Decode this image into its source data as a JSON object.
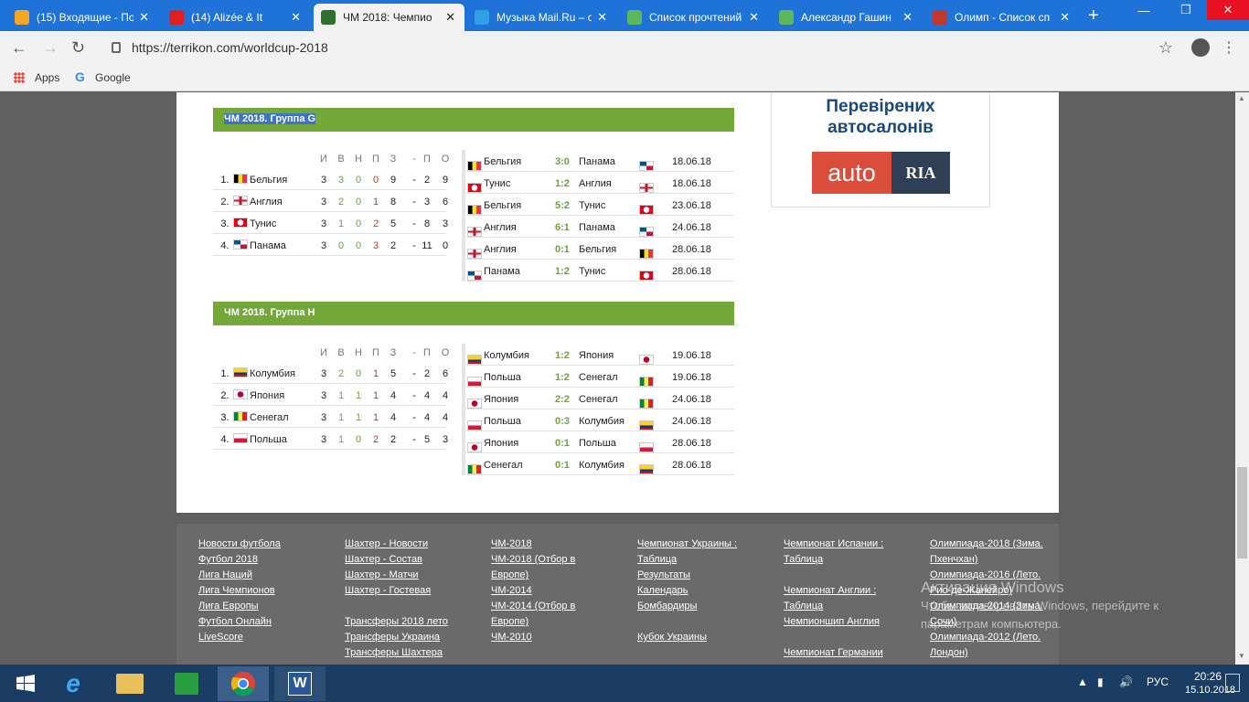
{
  "browser": {
    "tabs": [
      {
        "title": "(15) Входящие - По",
        "icon": "mailru-icon",
        "color": "#f5a623"
      },
      {
        "title": "(14) Alizée & It",
        "icon": "youtube-icon",
        "color": "#e02020"
      },
      {
        "title": "ЧМ 2018: Чемпио",
        "icon": "terrikon-icon",
        "color": "#2f6f2f",
        "active": true
      },
      {
        "title": "Музыка Mail.Ru – о",
        "icon": "mailru-music-icon",
        "color": "#2ea1e5"
      },
      {
        "title": "Список прочтений",
        "icon": "sheet-icon",
        "color": "#5cb85c"
      },
      {
        "title": "Александр Гашин",
        "icon": "sheet-icon",
        "color": "#5cb85c"
      },
      {
        "title": "Олимп - Список сп",
        "icon": "olimp-icon",
        "color": "#c0392b"
      }
    ],
    "url": "https://terrikon.com/worldcup-2018",
    "bookmarks": [
      {
        "label": "Apps",
        "icon": "apps-grid-icon"
      },
      {
        "label": "Google",
        "icon": "google-icon"
      }
    ]
  },
  "ad": {
    "title_line1": "Перевірених",
    "title_line2": "автосалонів",
    "logo_left": "auto",
    "logo_right": "RIA"
  },
  "columns": {
    "p": "И",
    "w": "В",
    "d": "Н",
    "l": "П",
    "gf": "З",
    "sep": "-",
    "ga": "П",
    "pts": "О"
  },
  "groups": [
    {
      "title": "ЧМ 2018. Группа G",
      "standings": [
        {
          "pos": "1.",
          "team": "Бельгия",
          "flag": "belgium",
          "p": "3",
          "w": "3",
          "d": "0",
          "l": "0",
          "gf": "9",
          "sep": "-",
          "ga": "2",
          "pts": "9"
        },
        {
          "pos": "2.",
          "team": "Англия",
          "flag": "england",
          "p": "3",
          "w": "2",
          "d": "0",
          "l": "1",
          "gf": "8",
          "sep": "-",
          "ga": "3",
          "pts": "6"
        },
        {
          "pos": "3.",
          "team": "Тунис",
          "flag": "tunisia",
          "p": "3",
          "w": "1",
          "d": "0",
          "l": "2",
          "gf": "5",
          "sep": "-",
          "ga": "8",
          "pts": "3"
        },
        {
          "pos": "4.",
          "team": "Панама",
          "flag": "panama",
          "p": "3",
          "w": "0",
          "d": "0",
          "l": "3",
          "gf": "2",
          "sep": "-",
          "ga": "11",
          "pts": "0"
        }
      ],
      "matches": [
        {
          "home": "Бельгия",
          "hflag": "belgium",
          "score": "3:0",
          "away": "Панама",
          "aflag": "panama",
          "date": "18.06.18"
        },
        {
          "home": "Тунис",
          "hflag": "tunisia",
          "score": "1:2",
          "away": "Англия",
          "aflag": "england",
          "date": "18.06.18"
        },
        {
          "home": "Бельгия",
          "hflag": "belgium",
          "score": "5:2",
          "away": "Тунис",
          "aflag": "tunisia",
          "date": "23.06.18"
        },
        {
          "home": "Англия",
          "hflag": "england",
          "score": "6:1",
          "away": "Панама",
          "aflag": "panama",
          "date": "24.06.18"
        },
        {
          "home": "Англия",
          "hflag": "england",
          "score": "0:1",
          "away": "Бельгия",
          "aflag": "belgium",
          "date": "28.06.18"
        },
        {
          "home": "Панама",
          "hflag": "panama",
          "score": "1:2",
          "away": "Тунис",
          "aflag": "tunisia",
          "date": "28.06.18"
        }
      ]
    },
    {
      "title": "ЧМ 2018. Группа H",
      "standings": [
        {
          "pos": "1.",
          "team": "Колумбия",
          "flag": "colombia",
          "p": "3",
          "w": "2",
          "d": "0",
          "l": "1",
          "gf": "5",
          "sep": "-",
          "ga": "2",
          "pts": "6"
        },
        {
          "pos": "2.",
          "team": "Япония",
          "flag": "japan",
          "p": "3",
          "w": "1",
          "d": "1",
          "l": "1",
          "gf": "4",
          "sep": "-",
          "ga": "4",
          "pts": "4"
        },
        {
          "pos": "3.",
          "team": "Сенегал",
          "flag": "senegal",
          "p": "3",
          "w": "1",
          "d": "1",
          "l": "1",
          "gf": "4",
          "sep": "-",
          "ga": "4",
          "pts": "4"
        },
        {
          "pos": "4.",
          "team": "Польша",
          "flag": "poland",
          "p": "3",
          "w": "1",
          "d": "0",
          "l": "2",
          "gf": "2",
          "sep": "-",
          "ga": "5",
          "pts": "3"
        }
      ],
      "matches": [
        {
          "home": "Колумбия",
          "hflag": "colombia",
          "score": "1:2",
          "away": "Япония",
          "aflag": "japan",
          "date": "19.06.18"
        },
        {
          "home": "Польша",
          "hflag": "poland",
          "score": "1:2",
          "away": "Сенегал",
          "aflag": "senegal",
          "date": "19.06.18"
        },
        {
          "home": "Япония",
          "hflag": "japan",
          "score": "2:2",
          "away": "Сенегал",
          "aflag": "senegal",
          "date": "24.06.18"
        },
        {
          "home": "Польша",
          "hflag": "poland",
          "score": "0:3",
          "away": "Колумбия",
          "aflag": "colombia",
          "date": "24.06.18"
        },
        {
          "home": "Япония",
          "hflag": "japan",
          "score": "0:1",
          "away": "Польша",
          "aflag": "poland",
          "date": "28.06.18"
        },
        {
          "home": "Сенегал",
          "hflag": "senegal",
          "score": "0:1",
          "away": "Колумбия",
          "aflag": "colombia",
          "date": "28.06.18"
        }
      ]
    }
  ],
  "footer": [
    [
      "Новости футбола",
      "Футбол 2018",
      "Лига Наций",
      "Лига Чемпионов",
      "Лига Европы",
      "Футбол Онлайн",
      "LiveScore"
    ],
    [
      "Шахтер - Новости",
      "Шахтер - Состав",
      "Шахтер - Матчи",
      "Шахтер - Гостевая",
      "",
      "Трансферы 2018 лето",
      "Трансферы Украина",
      "Трансферы Шахтера"
    ],
    [
      "ЧМ-2018",
      "ЧМ-2018 (Отбор в",
      "Европе)",
      "ЧМ-2014",
      "ЧМ-2014 (Отбор в",
      "Европе)",
      "ЧМ-2010"
    ],
    [
      "Чемпионат Украины :",
      "Таблица",
      "Результаты",
      "Календарь",
      "Бомбардиры",
      "",
      "Кубок Украины"
    ],
    [
      "Чемпионат Испании :",
      "Таблица",
      "",
      "Чемпионат Англии :",
      "Таблица",
      "Чемпионшип Англия",
      "",
      "Чемпионат Германии"
    ],
    [
      "Олимпиада-2018 (Зима.",
      "Пхенчхан)",
      "Олимпиада-2016 (Лето.",
      "Рио-де-Жанейро)",
      "Олимпиада-2014 (Зима.",
      "Сочи)",
      "Олимпиада-2012 (Лето.",
      "Лондон)"
    ]
  ],
  "watermark": {
    "line1": "Активация Windows",
    "line2": "Чтобы активировать Windows, перейдите к",
    "line3": "параметрам компьютера."
  },
  "taskbar": {
    "lang": "РУС",
    "time": "20:26",
    "date": "15.10.2018"
  },
  "flag_colors": {
    "belgium": [
      "#000000",
      "#fdda24",
      "#ef3340"
    ],
    "england": [
      "#ffffff",
      "#ce1124"
    ],
    "tunisia": [
      "#e70013",
      "#ffffff"
    ],
    "panama": [
      "#ffffff",
      "#d21034",
      "#005293"
    ],
    "colombia": [
      "#fcd116",
      "#003893",
      "#ce1126"
    ],
    "japan": [
      "#ffffff",
      "#bc002d"
    ],
    "senegal": [
      "#00853f",
      "#fdef42",
      "#e31b23"
    ],
    "poland": [
      "#ffffff",
      "#dc143c"
    ]
  }
}
